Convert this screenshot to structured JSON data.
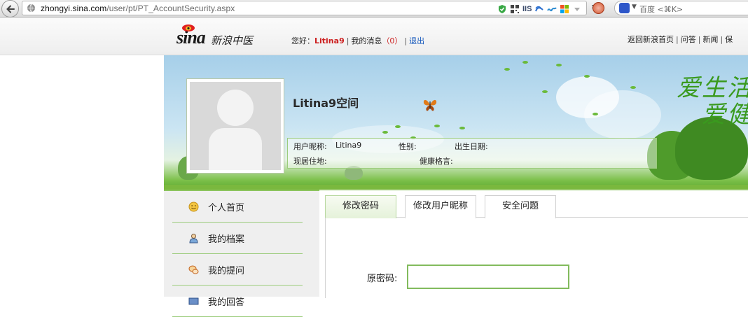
{
  "browser": {
    "url_host": "zhongyi.sina.com",
    "url_path": "/user/pt/PT_AccountSecurity.aspx",
    "url_prefix": "",
    "ext_iis": "IIS",
    "search_placeholder": "百度 <⌘K>"
  },
  "header": {
    "logo_text": "sina",
    "logo_cn": "新浪中医",
    "greeting": "您好：",
    "username": "Litina9",
    "messages_label": "我的消息",
    "messages_count": "（0）",
    "logout_label": "退出",
    "links": [
      "返回新浪首页",
      "问答",
      "新闻",
      "保"
    ]
  },
  "banner": {
    "space_title": "Litina9空间",
    "slogan_line1": "爱生活",
    "slogan_line2": "爱健",
    "info": {
      "nickname_label": "用户昵称:",
      "nickname_value": "Litina9",
      "gender_label": "性别:",
      "birthday_label": "出生日期:",
      "residence_label": "现居住地:",
      "motto_label": "健康格言:"
    }
  },
  "sidebar": {
    "items": [
      {
        "label": "个人首页",
        "icon": "smiley-icon"
      },
      {
        "label": "我的档案",
        "icon": "profile-icon"
      },
      {
        "label": "我的提问",
        "icon": "chat-bubbles-icon"
      },
      {
        "label": "我的回答",
        "icon": "answer-icon"
      }
    ]
  },
  "tabs": [
    {
      "label": "修改密码",
      "active": true
    },
    {
      "label": "修改用户昵称",
      "active": false
    },
    {
      "label": "安全问题",
      "active": false
    }
  ],
  "form": {
    "old_password_label": "原密码:",
    "old_password_value": ""
  },
  "colors": {
    "accent_green": "#82bb5d",
    "username_red": "#cc1e1e",
    "link_blue": "#1155bb"
  }
}
